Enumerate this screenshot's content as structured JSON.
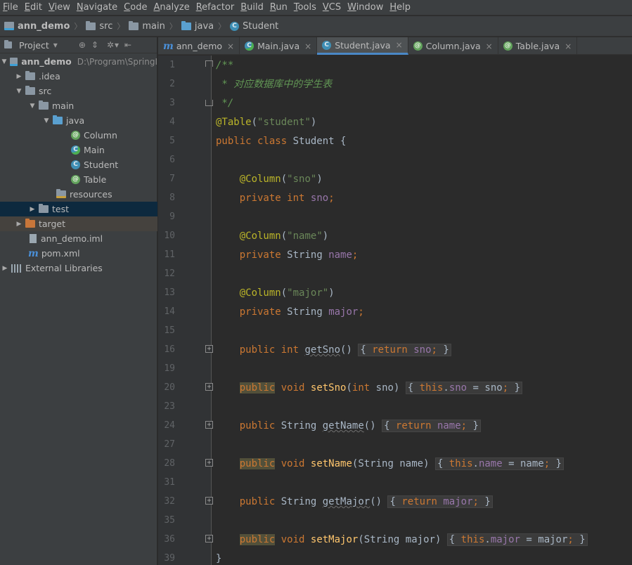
{
  "menu": [
    "File",
    "Edit",
    "View",
    "Navigate",
    "Code",
    "Analyze",
    "Refactor",
    "Build",
    "Run",
    "Tools",
    "VCS",
    "Window",
    "Help"
  ],
  "breadcrumb": [
    "ann_demo",
    "src",
    "main",
    "java",
    "Student"
  ],
  "project": {
    "title": "Project",
    "tree": [
      {
        "label": "ann_demo",
        "hint": "D:\\Program\\SpringI"
      },
      {
        "label": ".idea"
      },
      {
        "label": "src"
      },
      {
        "label": "main"
      },
      {
        "label": "java"
      },
      {
        "label": "Column"
      },
      {
        "label": "Main"
      },
      {
        "label": "Student"
      },
      {
        "label": "Table"
      },
      {
        "label": "resources"
      },
      {
        "label": "test"
      },
      {
        "label": "target"
      },
      {
        "label": "ann_demo.iml"
      },
      {
        "label": "pom.xml"
      },
      {
        "label": "External Libraries"
      }
    ]
  },
  "tabs": [
    "ann_demo",
    "Main.java",
    "Student.java",
    "Column.java",
    "Table.java"
  ],
  "active_tab": "Student.java",
  "line_numbers": [
    "1",
    "2",
    "3",
    "4",
    "5",
    "6",
    "7",
    "8",
    "9",
    "10",
    "11",
    "12",
    "13",
    "14",
    "15",
    "16",
    "19",
    "20",
    "23",
    "24",
    "27",
    "28",
    "31",
    "32",
    "35",
    "36",
    "39"
  ],
  "code": {
    "l1": "/**",
    "l2": " * 对应数据库中的学生表",
    "l3": " */",
    "l4_anno": "@Table",
    "l4_open": "(",
    "l4_str": "\"student\"",
    "l4_close": ")",
    "l5_kw": "public class",
    "l5_name": " Student {",
    "col_anno": "@Column",
    "col_open": "(",
    "col_close": ")",
    "sno_str": "\"sno\"",
    "name_str": "\"name\"",
    "major_str": "\"major\"",
    "private": "private",
    "int": "int",
    "public": "public",
    "void": "void",
    "return": "return",
    "this": "this",
    "string_type": "String",
    "sno": "sno",
    "name": "name",
    "major": "major",
    "getSno": "getSno",
    "setSno": "setSno",
    "getName": "getName",
    "setName": "setName",
    "getMajor": "getMajor",
    "setMajor": "setMajor",
    "closing": "}"
  }
}
